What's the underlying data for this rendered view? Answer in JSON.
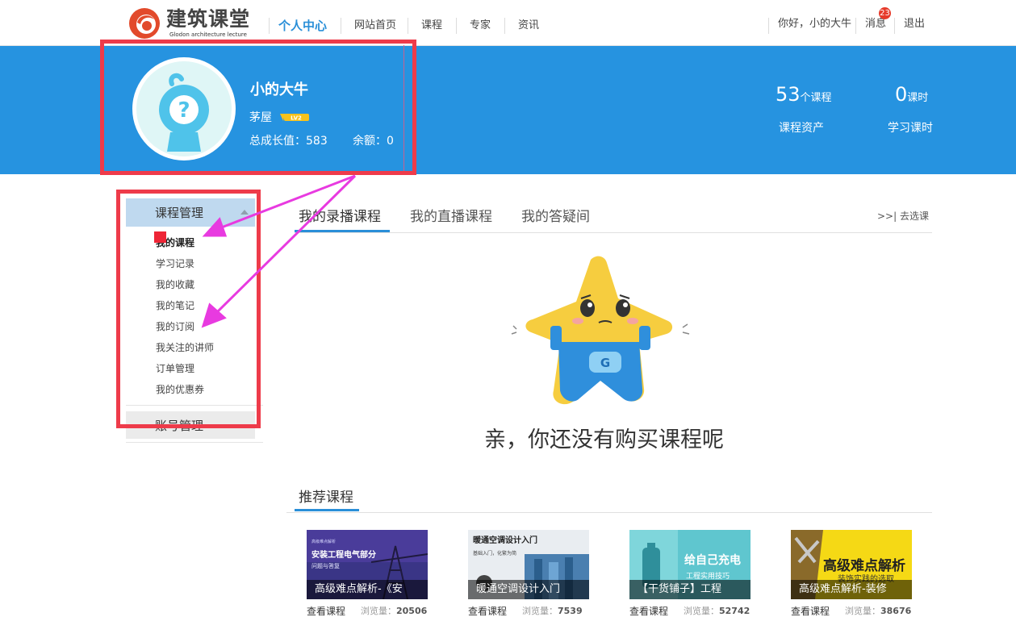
{
  "logo": {
    "cn": "建筑课堂",
    "en": "Glodon architecture lecture"
  },
  "nav": {
    "items": [
      "个人中心",
      "网站首页",
      "课程",
      "专家",
      "资讯"
    ],
    "greeting": "你好，小的大牛",
    "messages_label": "消息",
    "messages_count": "23",
    "logout": "退出"
  },
  "profile": {
    "username": "小的大牛",
    "level": "茅屋",
    "level_badge": "LV2",
    "growth_label": "总成长值：583",
    "balance_label": "余额：0"
  },
  "stats": {
    "courses_num": "53",
    "courses_unit": "个课程",
    "courses_caption": "课程资产",
    "hours_num": "0",
    "hours_unit": "课时",
    "hours_caption": "学习课时"
  },
  "sidebar": {
    "section1": "课程管理",
    "links": [
      "我的课程",
      "学习记录",
      "我的收藏",
      "我的笔记",
      "我的订阅",
      "我关注的讲师",
      "订单管理",
      "我的优惠券"
    ],
    "section2": "账号管理"
  },
  "tabs": [
    "我的录播课程",
    "我的直播课程",
    "我的答疑间"
  ],
  "go_select": ">>| 去选课",
  "empty_message": "亲，你还没有购买课程呢",
  "recommend": {
    "title": "推荐课程",
    "view_label": "查看课程",
    "views_prefix": "浏览量：",
    "cards": [
      {
        "caption": "高级难点解析-《安",
        "views": "20506",
        "thumb_text": "安装工程电气部分",
        "thumb_sub": "问题与答复"
      },
      {
        "caption": "暖通空调设计入门",
        "views": "7539",
        "thumb_text": "暖通空调设计入门",
        "thumb_sub": "基础入门，化繁为简"
      },
      {
        "caption": "【干货铺子】工程",
        "views": "52742",
        "thumb_text": "给自己充电",
        "thumb_sub": "工程实用技巧"
      },
      {
        "caption": "高级难点解析-装修",
        "views": "38676",
        "thumb_text": "高级难点解析",
        "thumb_sub": "装饰实践的选取"
      }
    ]
  },
  "colors": {
    "brand_blue": "#2693e0",
    "active_blue": "#2a8fd8",
    "annotation_red": "#ee3b4a",
    "annotation_magenta": "#e83ae0"
  }
}
